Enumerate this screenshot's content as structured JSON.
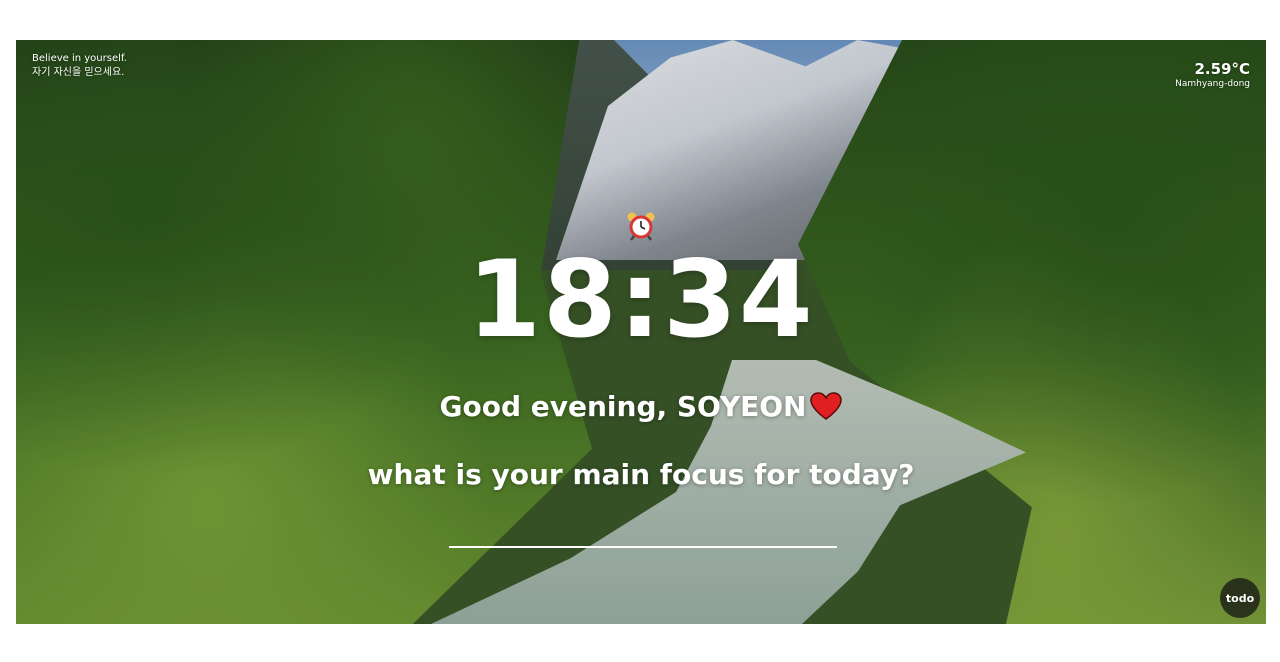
{
  "quote": {
    "english": "Believe in yourself.",
    "korean": "자기 자신을 믿으세요."
  },
  "weather": {
    "temperature": "2.59°C",
    "location": "Namhyang-dong"
  },
  "clock": {
    "time": "18:34",
    "icon": "alarm-clock-icon"
  },
  "greeting": {
    "text": "Good evening,  SOYEON",
    "icon": "heart-icon",
    "icon_color": "#e02020"
  },
  "focus": {
    "prompt": "what is your main focus for today?",
    "input_value": ""
  },
  "todo": {
    "label": "todo"
  }
}
